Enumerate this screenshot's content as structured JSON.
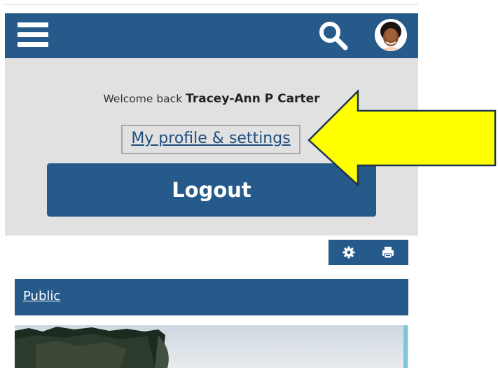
{
  "header": {
    "menu_icon": "hamburger-menu-icon",
    "search_icon": "search-icon",
    "avatar_icon": "user-avatar"
  },
  "user_panel": {
    "welcome_text": "Welcome back",
    "user_name": "Tracey-Ann P Carter",
    "profile_link": "My profile & settings",
    "logout_label": "Logout"
  },
  "annotation": {
    "arrow_color": "#ffff00",
    "arrow_direction": "left"
  },
  "toolbar": {
    "settings_icon": "gear-icon",
    "print_icon": "printer-icon"
  },
  "section": {
    "title": "Public"
  },
  "colors": {
    "brand": "#265a8a",
    "panel": "#e1e1e1",
    "link": "#1f4e7e"
  }
}
